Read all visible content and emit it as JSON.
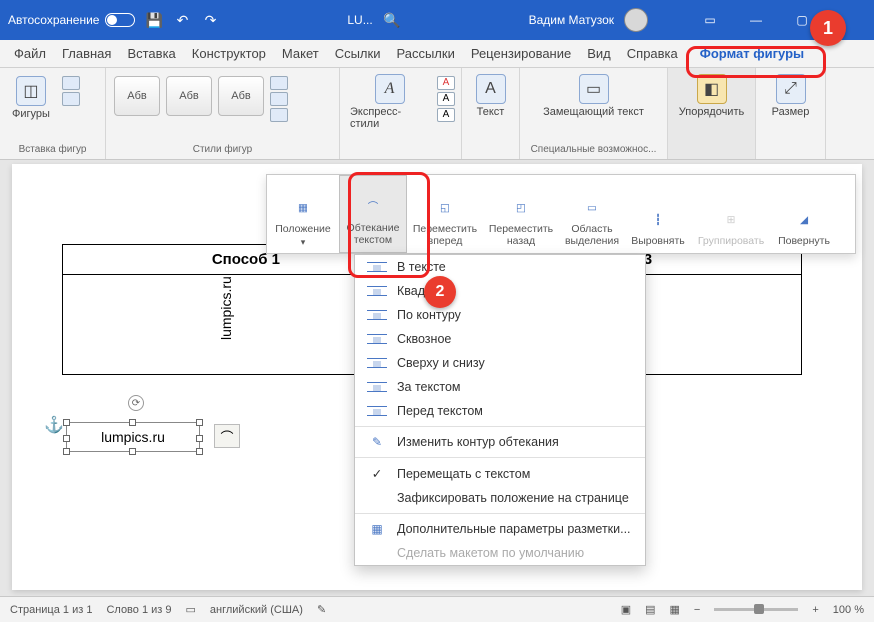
{
  "titlebar": {
    "autosave": "Автосохранение",
    "doc": "LU...",
    "user": "Вадим Матузок"
  },
  "tabs": [
    "Файл",
    "Главная",
    "Вставка",
    "Конструктор",
    "Макет",
    "Ссылки",
    "Рассылки",
    "Рецензирование",
    "Вид",
    "Справка",
    "Формат фигуры"
  ],
  "ribbon": {
    "shapes": "Фигуры",
    "g_insert": "Вставка фигур",
    "g_styles": "Стили фигур",
    "sample": "Абв",
    "express": "Экспресс-стили",
    "text": "Текст",
    "alt": "Замещающий текст",
    "g_access": "Специальные возможнос...",
    "arrange": "Упорядочить",
    "size": "Размер"
  },
  "arrange": {
    "position": "Положение",
    "wrap": "Обтекание текстом",
    "forward": "Переместить вперед",
    "backward": "Переместить назад",
    "selection": "Область выделения",
    "align": "Выровнять",
    "group": "Группировать",
    "rotate": "Повернуть"
  },
  "menu": {
    "inline": "В тексте",
    "square": "Квадрат",
    "tight": "По контуру",
    "through": "Сквозное",
    "topbottom": "Сверху и снизу",
    "behind": "За текстом",
    "infront": "Перед текстом",
    "edit": "Изменить контур обтекания",
    "move": "Перемещать с текстом",
    "fix": "Зафиксировать положение на странице",
    "more": "Дополнительные параметры разметки...",
    "default": "Сделать макетом по умолчанию"
  },
  "doc": {
    "col1": "Способ 1",
    "col3": "Способ 3",
    "watermark": "lumpics.ru",
    "shape_text": "lumpics.ru"
  },
  "status": {
    "page": "Страница 1 из 1",
    "words": "Слово 1 из 9",
    "lang": "английский (США)",
    "zoom": "100 %"
  },
  "badges": {
    "n1": "1",
    "n2": "2"
  }
}
